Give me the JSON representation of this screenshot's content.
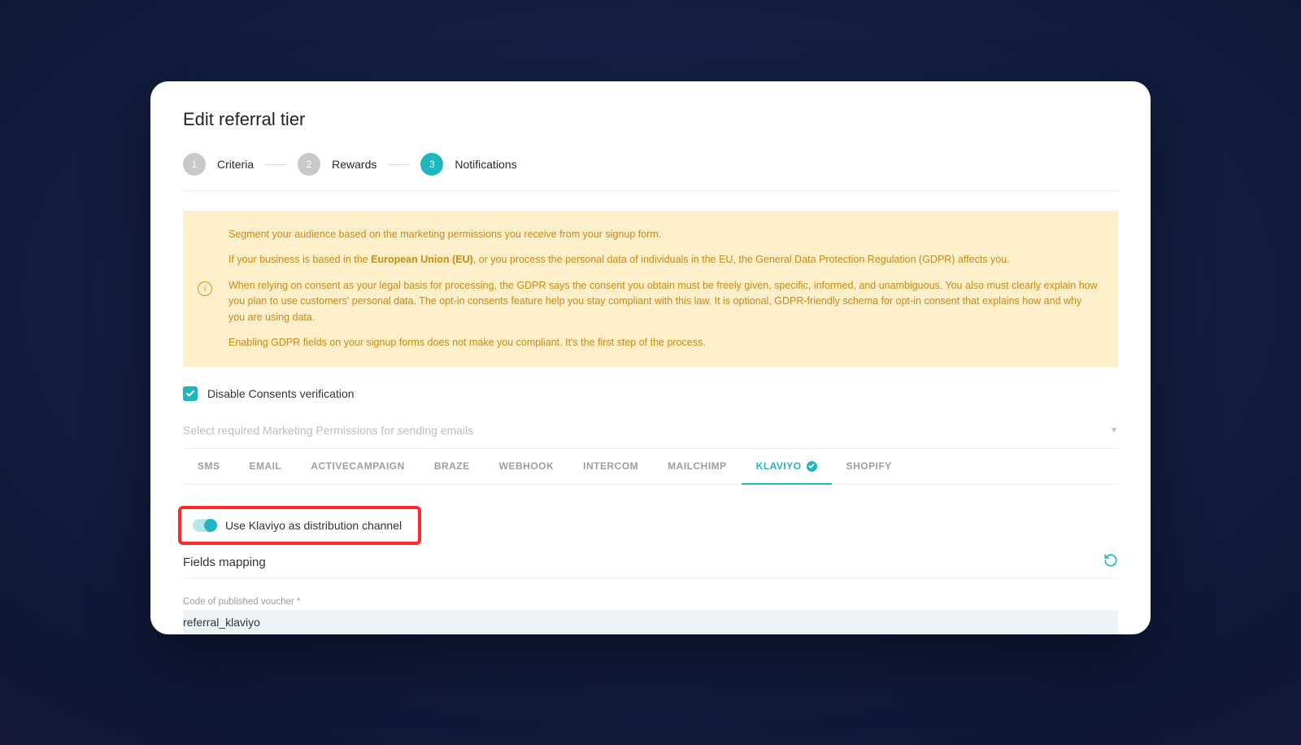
{
  "page_title": "Edit referral tier",
  "stepper": {
    "steps": [
      {
        "num": "1",
        "label": "Criteria",
        "active": false
      },
      {
        "num": "2",
        "label": "Rewards",
        "active": false
      },
      {
        "num": "3",
        "label": "Notifications",
        "active": true
      }
    ]
  },
  "alert": {
    "p1": "Segment your audience based on the marketing permissions you receive from your signup form.",
    "p2_before": "If your business is based in the ",
    "p2_bold": "European Union (EU)",
    "p2_after": ", or you process the personal data of individuals in the EU, the General Data Protection Regulation (GDPR) affects you.",
    "p3": "When relying on consent as your legal basis for processing, the GDPR says the consent you obtain must be freely given, specific, informed, and unambiguous. You also must clearly explain how you plan to use customers' personal data. The opt-in consents feature help you stay compliant with this law. It is optional, GDPR-friendly schema for opt-in consent that explains how and why you are using data.",
    "p4": "Enabling GDPR fields on your signup forms does not make you compliant. It's the first step of the process."
  },
  "disable_consents": {
    "checked": true,
    "label": "Disable Consents verification"
  },
  "marketing_select": {
    "placeholder": "Select required Marketing Permissions for sending emails"
  },
  "tabs": [
    {
      "id": "sms",
      "label": "SMS",
      "active": false,
      "badge": false
    },
    {
      "id": "email",
      "label": "EMAIL",
      "active": false,
      "badge": false
    },
    {
      "id": "activecampaign",
      "label": "ACTIVECAMPAIGN",
      "active": false,
      "badge": false
    },
    {
      "id": "braze",
      "label": "BRAZE",
      "active": false,
      "badge": false
    },
    {
      "id": "webhook",
      "label": "WEBHOOK",
      "active": false,
      "badge": false
    },
    {
      "id": "intercom",
      "label": "INTERCOM",
      "active": false,
      "badge": false
    },
    {
      "id": "mailchimp",
      "label": "MAILCHIMP",
      "active": false,
      "badge": false
    },
    {
      "id": "klaviyo",
      "label": "KLAVIYO",
      "active": true,
      "badge": true
    },
    {
      "id": "shopify",
      "label": "SHOPIFY",
      "active": false,
      "badge": false
    }
  ],
  "toggle": {
    "on": true,
    "label": "Use Klaviyo as distribution channel"
  },
  "fields_mapping": {
    "title": "Fields mapping",
    "field1_label": "Code of published voucher *",
    "field1_value": "referral_klaviyo"
  }
}
